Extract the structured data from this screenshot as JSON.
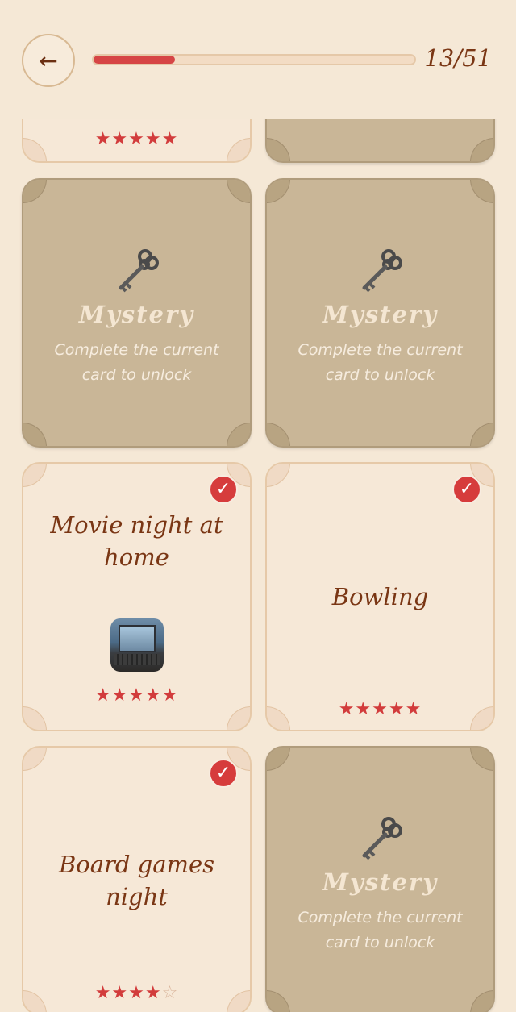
{
  "header": {
    "back_icon": "←",
    "progress_text": "13/51",
    "progress_fraction": 0.255
  },
  "cards": [
    {
      "id": "top-left",
      "state": "done",
      "stars": "★★★★★"
    },
    {
      "id": "top-right",
      "state": "locked"
    },
    {
      "id": "mystery-1",
      "state": "locked",
      "title": "Mystery",
      "subtitle": "Complete the current card to unlock",
      "icon": "key-icon"
    },
    {
      "id": "mystery-2",
      "state": "locked",
      "title": "Mystery",
      "subtitle": "Complete the current card to unlock",
      "icon": "key-icon"
    },
    {
      "id": "movie-night",
      "state": "done",
      "title": "Movie night at home",
      "stars": "★★★★★",
      "checkmark": "✓",
      "thumbnail": "laptop-photo"
    },
    {
      "id": "bowling",
      "state": "done",
      "title": "Bowling",
      "stars": "★★★★★",
      "checkmark": "✓"
    },
    {
      "id": "board-games",
      "state": "done",
      "title": "Board games night",
      "stars_filled": "★★★★",
      "stars_empty": "☆",
      "checkmark": "✓"
    },
    {
      "id": "mystery-3",
      "state": "locked",
      "title": "Mystery",
      "subtitle": "Complete the current card to unlock",
      "icon": "key-icon"
    }
  ],
  "colors": {
    "background": "#f5e8d6",
    "accent_red": "#d64545",
    "title_brown": "#7a3614",
    "locked_card": "#c9b697"
  }
}
